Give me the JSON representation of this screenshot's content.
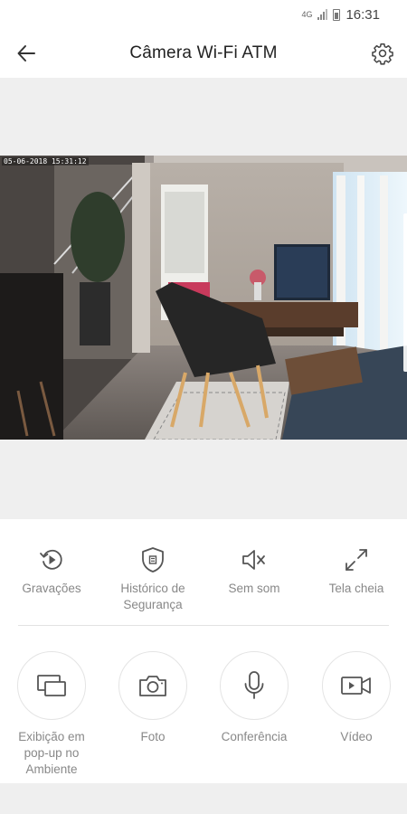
{
  "status_bar": {
    "network_label": "4G",
    "time": "16:31"
  },
  "header": {
    "title": "Câmera Wi-Fi ATM"
  },
  "video": {
    "osd_timestamp": "05-06-2018 15:31:12"
  },
  "controls": [
    {
      "label": "Gravações",
      "icon": "playback-icon"
    },
    {
      "label": "Histórico de Segurança",
      "icon": "shield-icon"
    },
    {
      "label": "Sem som",
      "icon": "mute-icon"
    },
    {
      "label": "Tela cheia",
      "icon": "fullscreen-icon"
    }
  ],
  "actions": [
    {
      "label": "Exibição em pop-up no Ambiente",
      "icon": "picture-in-picture-icon"
    },
    {
      "label": "Foto",
      "icon": "camera-icon"
    },
    {
      "label": "Conferência",
      "icon": "microphone-icon"
    },
    {
      "label": "Vídeo",
      "icon": "video-camera-icon"
    }
  ],
  "colors": {
    "background": "#ffffff",
    "panel_gray": "#efefef",
    "label_gray": "#888888",
    "icon_gray": "#555555"
  }
}
